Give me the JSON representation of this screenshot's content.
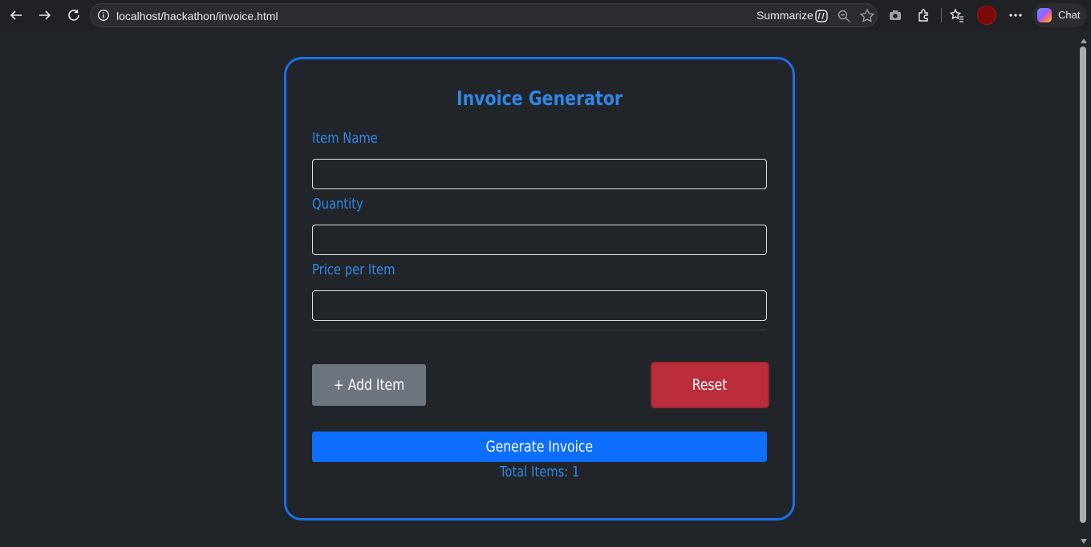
{
  "browser": {
    "url": "localhost/hackathon/invoice.html",
    "summarize_label": "Summarize",
    "chat_label": "Chat"
  },
  "form": {
    "title": "Invoice Generator",
    "item_name_label": "Item Name",
    "item_name_value": "",
    "quantity_label": "Quantity",
    "quantity_value": "",
    "price_label": "Price per Item",
    "price_value": "",
    "add_item_label": "+ Add Item",
    "reset_label": "Reset",
    "generate_label": "Generate Invoice",
    "total_items_text": "Total Items: 1"
  },
  "colors": {
    "accent": "#2f86e6",
    "card_border": "#1a6fe8",
    "primary_button": "#0d6efd",
    "secondary_button": "#6c757d",
    "danger_button": "#bb2d3b",
    "background": "#212529"
  }
}
